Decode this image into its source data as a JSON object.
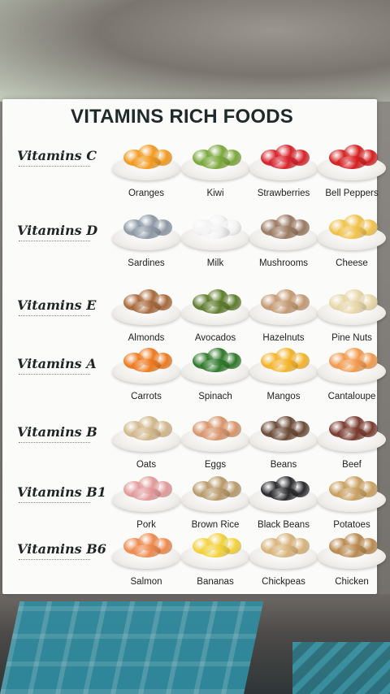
{
  "title": "VITAMINS RICH FOODS",
  "groups": [
    {
      "label": "Vitamins C",
      "foods": [
        {
          "name": "Oranges",
          "color": "#f39a1e"
        },
        {
          "name": "Kiwi",
          "color": "#7aa83a"
        },
        {
          "name": "Strawberries",
          "color": "#d8212a"
        },
        {
          "name": "Bell Peppers",
          "color": "#d61f1f"
        }
      ]
    },
    {
      "label": "Vitamins D",
      "foods": [
        {
          "name": "Sardines",
          "color": "#8d99a6"
        },
        {
          "name": "Milk",
          "color": "#f4f4f4"
        },
        {
          "name": "Mushrooms",
          "color": "#9b7a62"
        },
        {
          "name": "Cheese",
          "color": "#f2c24b"
        }
      ]
    },
    {
      "label": "Vitamins E",
      "foods": [
        {
          "name": "Almonds",
          "color": "#a8693a"
        },
        {
          "name": "Avocados",
          "color": "#5e7d2c"
        },
        {
          "name": "Hazelnuts",
          "color": "#c49a72"
        },
        {
          "name": "Pine Nuts",
          "color": "#e8d7a8"
        }
      ]
    },
    {
      "label": "Vitamins A",
      "foods": [
        {
          "name": "Carrots",
          "color": "#ee7a1e"
        },
        {
          "name": "Spinach",
          "color": "#2f7a2a"
        },
        {
          "name": "Mangos",
          "color": "#f5b42a"
        },
        {
          "name": "Cantaloupe",
          "color": "#f29a4c"
        }
      ]
    },
    {
      "label": "Vitamins B",
      "foods": [
        {
          "name": "Oats",
          "color": "#d2b78a"
        },
        {
          "name": "Eggs",
          "color": "#d9956a"
        },
        {
          "name": "Beans",
          "color": "#6b4a36"
        },
        {
          "name": "Beef",
          "color": "#7a3b2e"
        }
      ]
    },
    {
      "label": "Vitamins B1",
      "foods": [
        {
          "name": "Pork",
          "color": "#e39a9a"
        },
        {
          "name": "Brown Rice",
          "color": "#b99a6a"
        },
        {
          "name": "Black Beans",
          "color": "#2a2a2e"
        },
        {
          "name": "Potatoes",
          "color": "#c9a060"
        }
      ]
    },
    {
      "label": "Vitamins B6",
      "foods": [
        {
          "name": "Salmon",
          "color": "#ef8a4c"
        },
        {
          "name": "Bananas",
          "color": "#f3d23a"
        },
        {
          "name": "Chickpeas",
          "color": "#d9b47a"
        },
        {
          "name": "Chicken",
          "color": "#b98a4e"
        }
      ]
    }
  ]
}
